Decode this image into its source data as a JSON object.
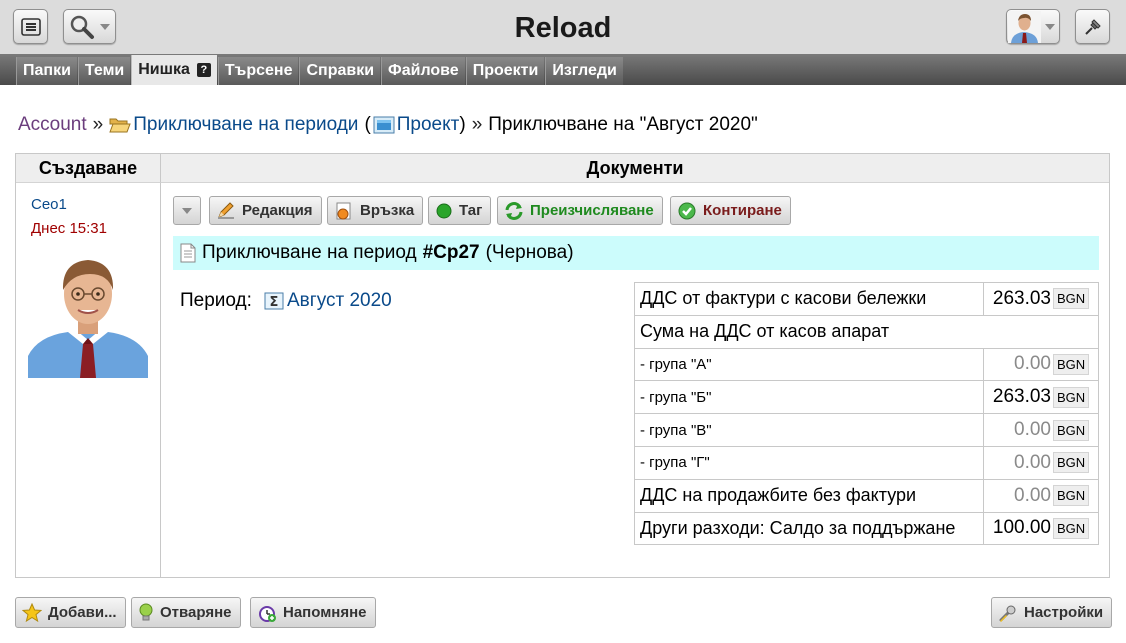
{
  "header": {
    "title": "Reload"
  },
  "tabs": [
    {
      "label": "Папки"
    },
    {
      "label": "Теми"
    },
    {
      "label": "Нишка",
      "active": true,
      "help": "?"
    },
    {
      "label": "Търсене"
    },
    {
      "label": "Справки"
    },
    {
      "label": "Файлове"
    },
    {
      "label": "Проекти"
    },
    {
      "label": "Изгледи"
    }
  ],
  "breadcrumb": {
    "account": "Account",
    "sep": "»",
    "folder": "Приключване на периоди",
    "paren_open": "(",
    "project": "Проект",
    "paren_close": ")",
    "sep2": "»",
    "current": "Приключване на \"Август 2020\""
  },
  "columns": {
    "left": "Създаване",
    "right": "Документи"
  },
  "creator": {
    "name": "Ceo1",
    "date": "Днес 15:31"
  },
  "toolbar": {
    "edit": "Редакция",
    "link": "Връзка",
    "tag": "Таг",
    "recalc": "Преизчисляване",
    "post": "Контиране"
  },
  "document": {
    "title_prefix": "Приключване на период",
    "handle": "#Cp27",
    "status": "(Чернова)"
  },
  "period": {
    "label": "Период:",
    "value": "Август 2020"
  },
  "grid": {
    "rows": [
      {
        "label": "ДДС от фактури с касови бележки",
        "value": "263.03",
        "currency": "BGN"
      },
      {
        "label": "Сума на ДДС от касов апарат"
      },
      {
        "label": "- група \"А\"",
        "value": "0.00",
        "currency": "BGN",
        "zero": true
      },
      {
        "label": "- група \"Б\"",
        "value": "263.03",
        "currency": "BGN"
      },
      {
        "label": "- група \"В\"",
        "value": "0.00",
        "currency": "BGN",
        "zero": true
      },
      {
        "label": "- група \"Г\"",
        "value": "0.00",
        "currency": "BGN",
        "zero": true
      },
      {
        "label": "ДДС на продажбите без фактури",
        "value": "0.00",
        "currency": "BGN",
        "zero": true
      },
      {
        "label": "Други разходи: Салдо за поддържане",
        "value": "100.00",
        "currency": "BGN"
      }
    ]
  },
  "bottom": {
    "add": "Добави...",
    "open": "Отваряне",
    "remind": "Напомняне",
    "settings": "Настройки"
  },
  "colors": {
    "link": "#0a4a8a",
    "account": "#6b3d7d",
    "date": "#a00000",
    "doc_bg": "#ccfcfc",
    "recalc": "#1f8a1f",
    "post": "#7a1c1c"
  }
}
